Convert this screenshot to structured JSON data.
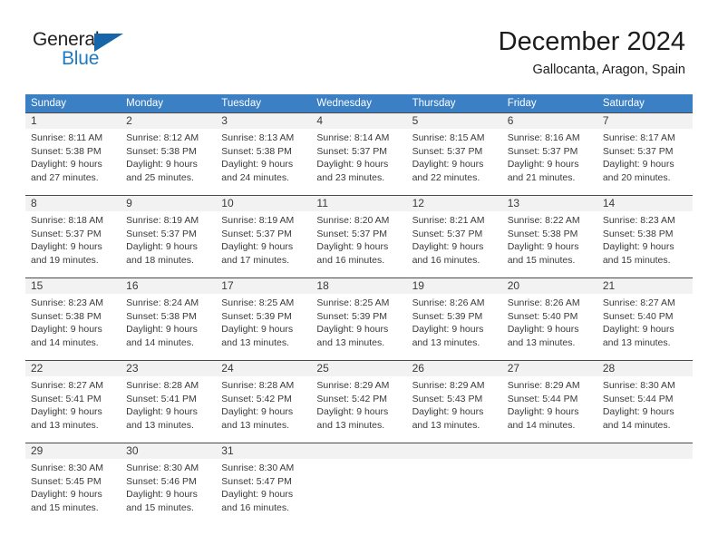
{
  "brand": {
    "name_part1": "General",
    "name_part2": "Blue",
    "triangle_color": "#1565a8",
    "blue_color": "#1f7ac0"
  },
  "header": {
    "month_title": "December 2024",
    "location": "Gallocanta, Aragon, Spain"
  },
  "calendar": {
    "header_color": "#3b7fc4",
    "daynum_band_color": "#f2f2f2",
    "weekdays": [
      "Sunday",
      "Monday",
      "Tuesday",
      "Wednesday",
      "Thursday",
      "Friday",
      "Saturday"
    ],
    "weeks": [
      [
        {
          "day": "1",
          "sunrise": "Sunrise: 8:11 AM",
          "sunset": "Sunset: 5:38 PM",
          "daylight_line1": "Daylight: 9 hours",
          "daylight_line2": "and 27 minutes."
        },
        {
          "day": "2",
          "sunrise": "Sunrise: 8:12 AM",
          "sunset": "Sunset: 5:38 PM",
          "daylight_line1": "Daylight: 9 hours",
          "daylight_line2": "and 25 minutes."
        },
        {
          "day": "3",
          "sunrise": "Sunrise: 8:13 AM",
          "sunset": "Sunset: 5:38 PM",
          "daylight_line1": "Daylight: 9 hours",
          "daylight_line2": "and 24 minutes."
        },
        {
          "day": "4",
          "sunrise": "Sunrise: 8:14 AM",
          "sunset": "Sunset: 5:37 PM",
          "daylight_line1": "Daylight: 9 hours",
          "daylight_line2": "and 23 minutes."
        },
        {
          "day": "5",
          "sunrise": "Sunrise: 8:15 AM",
          "sunset": "Sunset: 5:37 PM",
          "daylight_line1": "Daylight: 9 hours",
          "daylight_line2": "and 22 minutes."
        },
        {
          "day": "6",
          "sunrise": "Sunrise: 8:16 AM",
          "sunset": "Sunset: 5:37 PM",
          "daylight_line1": "Daylight: 9 hours",
          "daylight_line2": "and 21 minutes."
        },
        {
          "day": "7",
          "sunrise": "Sunrise: 8:17 AM",
          "sunset": "Sunset: 5:37 PM",
          "daylight_line1": "Daylight: 9 hours",
          "daylight_line2": "and 20 minutes."
        }
      ],
      [
        {
          "day": "8",
          "sunrise": "Sunrise: 8:18 AM",
          "sunset": "Sunset: 5:37 PM",
          "daylight_line1": "Daylight: 9 hours",
          "daylight_line2": "and 19 minutes."
        },
        {
          "day": "9",
          "sunrise": "Sunrise: 8:19 AM",
          "sunset": "Sunset: 5:37 PM",
          "daylight_line1": "Daylight: 9 hours",
          "daylight_line2": "and 18 minutes."
        },
        {
          "day": "10",
          "sunrise": "Sunrise: 8:19 AM",
          "sunset": "Sunset: 5:37 PM",
          "daylight_line1": "Daylight: 9 hours",
          "daylight_line2": "and 17 minutes."
        },
        {
          "day": "11",
          "sunrise": "Sunrise: 8:20 AM",
          "sunset": "Sunset: 5:37 PM",
          "daylight_line1": "Daylight: 9 hours",
          "daylight_line2": "and 16 minutes."
        },
        {
          "day": "12",
          "sunrise": "Sunrise: 8:21 AM",
          "sunset": "Sunset: 5:37 PM",
          "daylight_line1": "Daylight: 9 hours",
          "daylight_line2": "and 16 minutes."
        },
        {
          "day": "13",
          "sunrise": "Sunrise: 8:22 AM",
          "sunset": "Sunset: 5:38 PM",
          "daylight_line1": "Daylight: 9 hours",
          "daylight_line2": "and 15 minutes."
        },
        {
          "day": "14",
          "sunrise": "Sunrise: 8:23 AM",
          "sunset": "Sunset: 5:38 PM",
          "daylight_line1": "Daylight: 9 hours",
          "daylight_line2": "and 15 minutes."
        }
      ],
      [
        {
          "day": "15",
          "sunrise": "Sunrise: 8:23 AM",
          "sunset": "Sunset: 5:38 PM",
          "daylight_line1": "Daylight: 9 hours",
          "daylight_line2": "and 14 minutes."
        },
        {
          "day": "16",
          "sunrise": "Sunrise: 8:24 AM",
          "sunset": "Sunset: 5:38 PM",
          "daylight_line1": "Daylight: 9 hours",
          "daylight_line2": "and 14 minutes."
        },
        {
          "day": "17",
          "sunrise": "Sunrise: 8:25 AM",
          "sunset": "Sunset: 5:39 PM",
          "daylight_line1": "Daylight: 9 hours",
          "daylight_line2": "and 13 minutes."
        },
        {
          "day": "18",
          "sunrise": "Sunrise: 8:25 AM",
          "sunset": "Sunset: 5:39 PM",
          "daylight_line1": "Daylight: 9 hours",
          "daylight_line2": "and 13 minutes."
        },
        {
          "day": "19",
          "sunrise": "Sunrise: 8:26 AM",
          "sunset": "Sunset: 5:39 PM",
          "daylight_line1": "Daylight: 9 hours",
          "daylight_line2": "and 13 minutes."
        },
        {
          "day": "20",
          "sunrise": "Sunrise: 8:26 AM",
          "sunset": "Sunset: 5:40 PM",
          "daylight_line1": "Daylight: 9 hours",
          "daylight_line2": "and 13 minutes."
        },
        {
          "day": "21",
          "sunrise": "Sunrise: 8:27 AM",
          "sunset": "Sunset: 5:40 PM",
          "daylight_line1": "Daylight: 9 hours",
          "daylight_line2": "and 13 minutes."
        }
      ],
      [
        {
          "day": "22",
          "sunrise": "Sunrise: 8:27 AM",
          "sunset": "Sunset: 5:41 PM",
          "daylight_line1": "Daylight: 9 hours",
          "daylight_line2": "and 13 minutes."
        },
        {
          "day": "23",
          "sunrise": "Sunrise: 8:28 AM",
          "sunset": "Sunset: 5:41 PM",
          "daylight_line1": "Daylight: 9 hours",
          "daylight_line2": "and 13 minutes."
        },
        {
          "day": "24",
          "sunrise": "Sunrise: 8:28 AM",
          "sunset": "Sunset: 5:42 PM",
          "daylight_line1": "Daylight: 9 hours",
          "daylight_line2": "and 13 minutes."
        },
        {
          "day": "25",
          "sunrise": "Sunrise: 8:29 AM",
          "sunset": "Sunset: 5:42 PM",
          "daylight_line1": "Daylight: 9 hours",
          "daylight_line2": "and 13 minutes."
        },
        {
          "day": "26",
          "sunrise": "Sunrise: 8:29 AM",
          "sunset": "Sunset: 5:43 PM",
          "daylight_line1": "Daylight: 9 hours",
          "daylight_line2": "and 13 minutes."
        },
        {
          "day": "27",
          "sunrise": "Sunrise: 8:29 AM",
          "sunset": "Sunset: 5:44 PM",
          "daylight_line1": "Daylight: 9 hours",
          "daylight_line2": "and 14 minutes."
        },
        {
          "day": "28",
          "sunrise": "Sunrise: 8:30 AM",
          "sunset": "Sunset: 5:44 PM",
          "daylight_line1": "Daylight: 9 hours",
          "daylight_line2": "and 14 minutes."
        }
      ],
      [
        {
          "day": "29",
          "sunrise": "Sunrise: 8:30 AM",
          "sunset": "Sunset: 5:45 PM",
          "daylight_line1": "Daylight: 9 hours",
          "daylight_line2": "and 15 minutes."
        },
        {
          "day": "30",
          "sunrise": "Sunrise: 8:30 AM",
          "sunset": "Sunset: 5:46 PM",
          "daylight_line1": "Daylight: 9 hours",
          "daylight_line2": "and 15 minutes."
        },
        {
          "day": "31",
          "sunrise": "Sunrise: 8:30 AM",
          "sunset": "Sunset: 5:47 PM",
          "daylight_line1": "Daylight: 9 hours",
          "daylight_line2": "and 16 minutes."
        },
        {
          "day": "",
          "sunrise": "",
          "sunset": "",
          "daylight_line1": "",
          "daylight_line2": ""
        },
        {
          "day": "",
          "sunrise": "",
          "sunset": "",
          "daylight_line1": "",
          "daylight_line2": ""
        },
        {
          "day": "",
          "sunrise": "",
          "sunset": "",
          "daylight_line1": "",
          "daylight_line2": ""
        },
        {
          "day": "",
          "sunrise": "",
          "sunset": "",
          "daylight_line1": "",
          "daylight_line2": ""
        }
      ]
    ]
  }
}
